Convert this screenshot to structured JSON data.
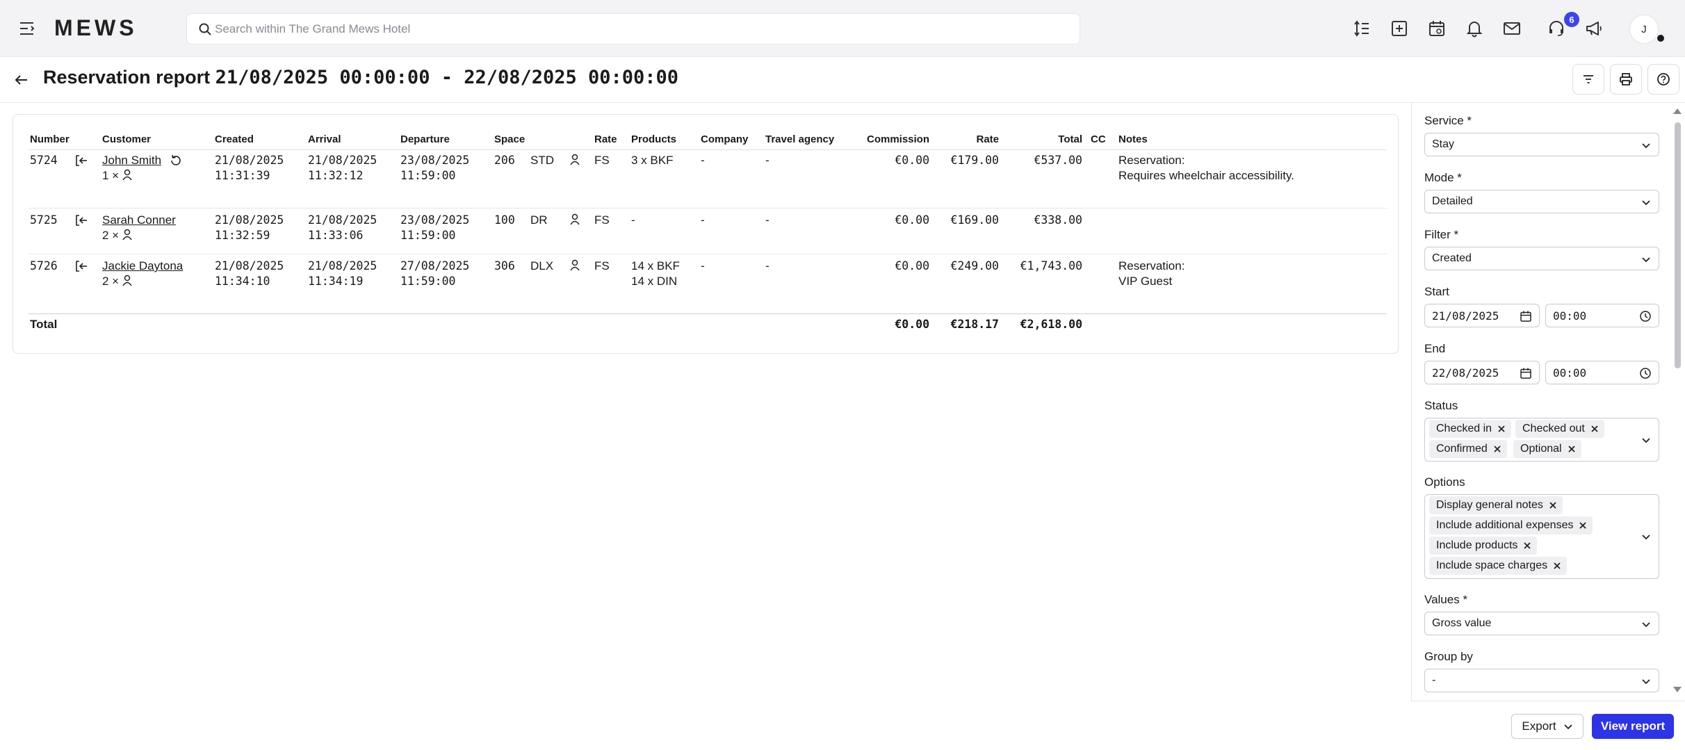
{
  "topbar": {
    "logo": "MEWS",
    "search_placeholder": "Search within The Grand Mews Hotel",
    "icons": [
      "menu-icon",
      "line-height-icon",
      "plus-square-icon",
      "calendar-icon",
      "bell-icon",
      "mail-icon",
      "headset-icon",
      "megaphone-icon"
    ],
    "notification_count": "6",
    "avatar_initial": "J"
  },
  "header": {
    "title_prefix": "Reservation report",
    "title_range": "21/08/2025 00:00:00 - 22/08/2025 00:00:00"
  },
  "table": {
    "columns": {
      "number": "Number",
      "customer": "Customer",
      "created": "Created",
      "arrival": "Arrival",
      "departure": "Departure",
      "space": "Space",
      "rate_code": "Rate",
      "products": "Products",
      "company": "Company",
      "travel_agency": "Travel agency",
      "commission": "Commission",
      "rate": "Rate",
      "total": "Total",
      "cc": "CC",
      "notes": "Notes"
    },
    "rows": [
      {
        "number": "5724",
        "customer": "John Smith",
        "guests": "1 ×",
        "created_date": "21/08/2025",
        "created_time": "11:31:39",
        "arrival_date": "21/08/2025",
        "arrival_time": "11:32:12",
        "departure_date": "23/08/2025",
        "departure_time": "11:59:00",
        "space": "206",
        "space_type": "STD",
        "rate_code": "FS",
        "products_1": "3 x BKF",
        "products_2": "",
        "company": "-",
        "travel_agency": "-",
        "commission": "€0.00",
        "rate": "€179.00",
        "total": "€537.00",
        "notes_1": "Reservation:",
        "notes_2": "Requires wheelchair accessibility."
      },
      {
        "number": "5725",
        "customer": "Sarah Conner",
        "guests": "2 ×",
        "created_date": "21/08/2025",
        "created_time": "11:32:59",
        "arrival_date": "21/08/2025",
        "arrival_time": "11:33:06",
        "departure_date": "23/08/2025",
        "departure_time": "11:59:00",
        "space": "100",
        "space_type": "DR",
        "rate_code": "FS",
        "products_1": "-",
        "products_2": "",
        "company": "-",
        "travel_agency": "-",
        "commission": "€0.00",
        "rate": "€169.00",
        "total": "€338.00",
        "notes_1": "",
        "notes_2": ""
      },
      {
        "number": "5726",
        "customer": "Jackie Daytona",
        "guests": "2 ×",
        "created_date": "21/08/2025",
        "created_time": "11:34:10",
        "arrival_date": "21/08/2025",
        "arrival_time": "11:34:19",
        "departure_date": "27/08/2025",
        "departure_time": "11:59:00",
        "space": "306",
        "space_type": "DLX",
        "rate_code": "FS",
        "products_1": "14 x BKF",
        "products_2": "14 x DIN",
        "company": "-",
        "travel_agency": "-",
        "commission": "€0.00",
        "rate": "€249.00",
        "total": "€1,743.00",
        "notes_1": "Reservation:",
        "notes_2": "VIP Guest"
      }
    ],
    "totals": {
      "label": "Total",
      "commission": "€0.00",
      "rate": "€218.17",
      "total": "€2,618.00"
    }
  },
  "panel": {
    "service": {
      "label": "Service *",
      "value": "Stay"
    },
    "mode": {
      "label": "Mode *",
      "value": "Detailed"
    },
    "filter": {
      "label": "Filter *",
      "value": "Created"
    },
    "start": {
      "label": "Start",
      "date": "21/08/2025",
      "time": "00:00"
    },
    "end": {
      "label": "End",
      "date": "22/08/2025",
      "time": "00:00"
    },
    "status": {
      "label": "Status",
      "chips": [
        "Checked in",
        "Checked out",
        "Confirmed",
        "Optional"
      ]
    },
    "options": {
      "label": "Options",
      "chips": [
        "Display general notes",
        "Include additional expenses",
        "Include products",
        "Include space charges"
      ]
    },
    "values": {
      "label": "Values *",
      "value": "Gross value"
    },
    "group_by": {
      "label": "Group by",
      "value": "-"
    }
  },
  "footer": {
    "export_label": "Export",
    "view_label": "View report"
  },
  "colors": {
    "primary": "#2d33e6",
    "badge": "#3b43f0",
    "chip_bg": "#efeff2"
  }
}
